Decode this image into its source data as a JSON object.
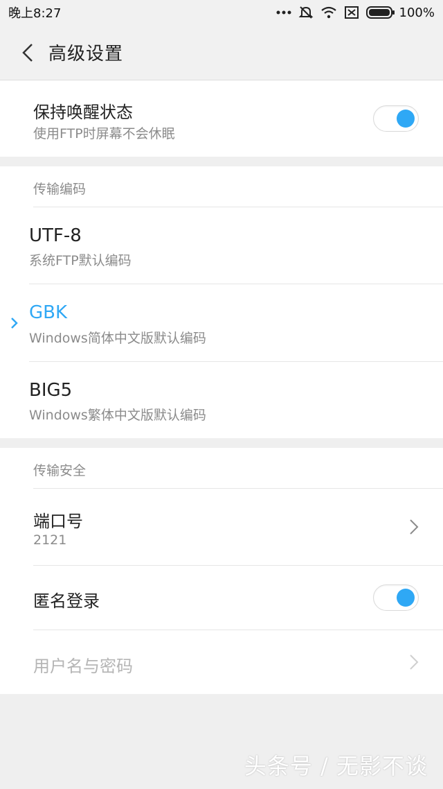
{
  "status_bar": {
    "time": "晚上8:27",
    "battery": "100%"
  },
  "header": {
    "title": "高级设置"
  },
  "keep_awake": {
    "title": "保持唤醒状态",
    "subtitle": "使用FTP时屏幕不会休眠",
    "enabled": true
  },
  "encoding": {
    "section_label": "传输编码",
    "options": [
      {
        "title": "UTF-8",
        "subtitle": "系统FTP默认编码",
        "selected": false
      },
      {
        "title": "GBK",
        "subtitle": "Windows简体中文版默认编码",
        "selected": true
      },
      {
        "title": "BIG5",
        "subtitle": "Windows繁体中文版默认编码",
        "selected": false
      }
    ]
  },
  "security": {
    "section_label": "传输安全",
    "port": {
      "title": "端口号",
      "value": "2121"
    },
    "anonymous": {
      "title": "匿名登录",
      "enabled": true
    },
    "credentials": {
      "title": "用户名与密码",
      "disabled": true
    }
  },
  "watermark": "头条号 / 无影不谈",
  "colors": {
    "accent": "#2fa8f5",
    "secondary_text": "#8b8b8b",
    "disabled_text": "#b5b5b5"
  }
}
